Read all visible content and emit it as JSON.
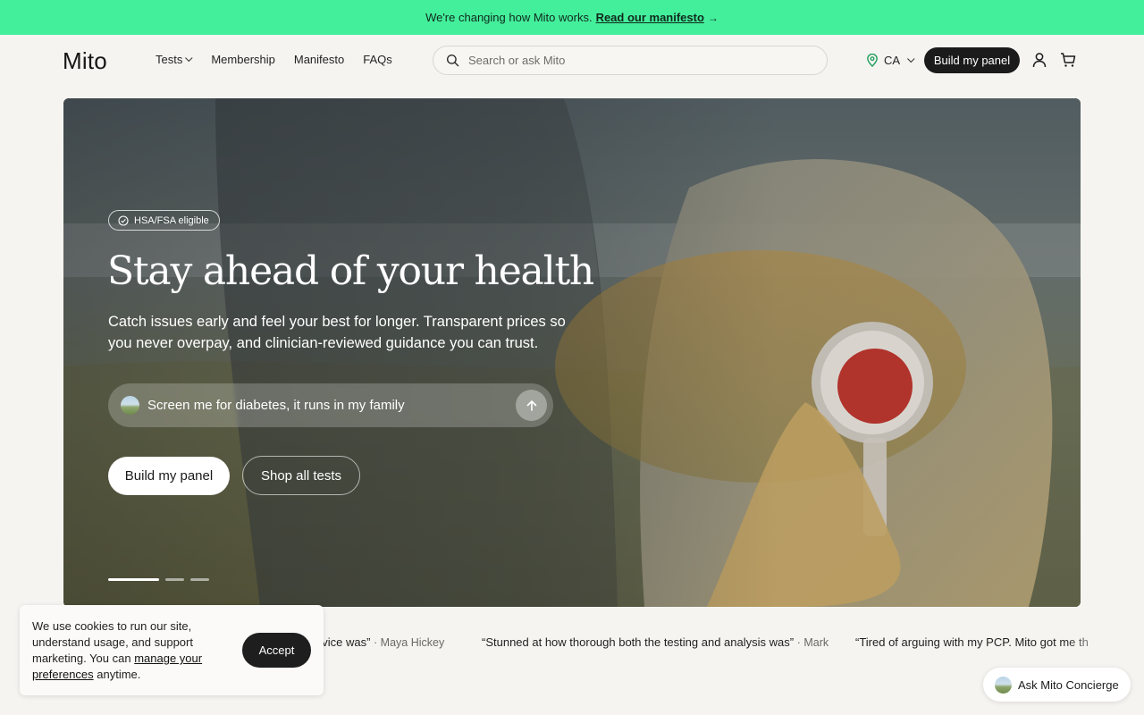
{
  "announcement": {
    "text": "We're changing how Mito works.",
    "link_label": "Read our manifesto",
    "arrow": "→"
  },
  "header": {
    "logo": "Mito",
    "nav": [
      {
        "label": "Tests",
        "has_dropdown": true
      },
      {
        "label": "Membership"
      },
      {
        "label": "Manifesto"
      },
      {
        "label": "FAQs"
      }
    ],
    "search_placeholder": "Search or ask Mito",
    "region": "CA",
    "cta_label": "Build my panel",
    "icons": [
      "search-icon",
      "location-pin-icon",
      "user-icon",
      "cart-icon"
    ]
  },
  "hero": {
    "badge": "HSA/FSA eligible",
    "title": "Stay ahead of your health",
    "subtitle": "Catch issues early and feel your best for longer. Transparent prices so you never overpay, and clinician-reviewed guidance you can trust.",
    "ask_text": "Screen me for diabetes, it runs in my family",
    "primary_button": "Build my panel",
    "secondary_button": "Shop all tests",
    "slides_total": 3,
    "active_slide": 1
  },
  "testimonials": [
    {
      "quote": "dvice was”",
      "author": "· Maya Hickey"
    },
    {
      "quote": "“Stunned at how thorough both the testing and analysis was”",
      "author": "· Mark"
    },
    {
      "quote": "“Tired of arguing with my PCP. Mito got me th",
      "author": ""
    }
  ],
  "cookie": {
    "text": "We use cookies to run our site, understand usage, and support marketing. You can",
    "link": "manage your preferences",
    "suffix": " anytime.",
    "accept": "Accept"
  },
  "concierge": {
    "label": "Ask Mito Concierge"
  },
  "colors": {
    "announcement_bg": "#44ef9c",
    "page_bg": "#f5f4f1",
    "primary_dark": "#1b1b1b"
  }
}
